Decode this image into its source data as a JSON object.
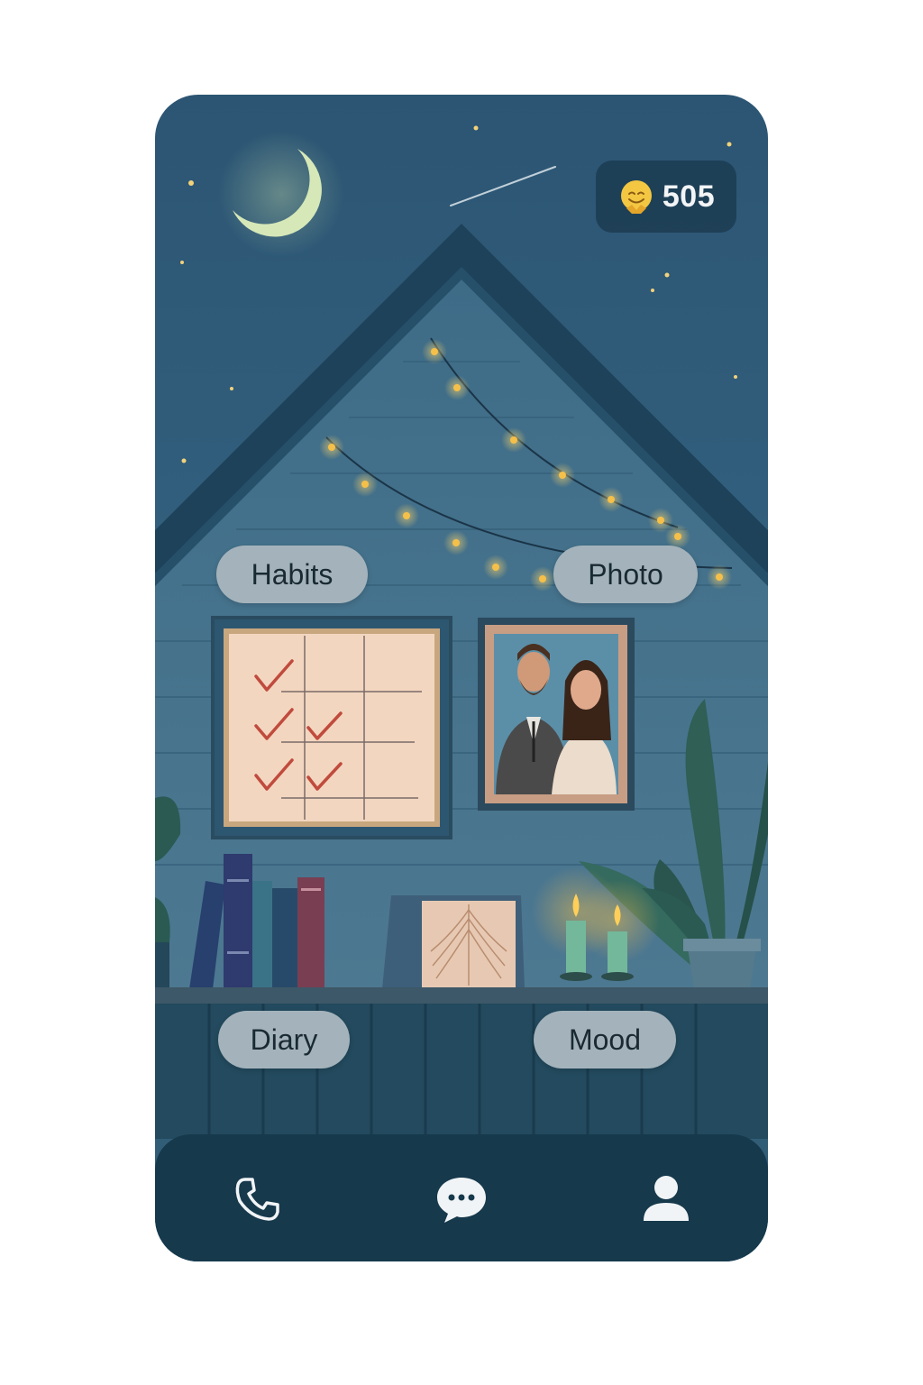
{
  "status": {
    "coins": "505",
    "coin_icon": "smiley-coin-icon"
  },
  "rooms": {
    "habits_label": "Habits",
    "photo_label": "Photo",
    "diary_label": "Diary",
    "mood_label": "Mood"
  },
  "bottom_nav": [
    {
      "icon": "phone-icon"
    },
    {
      "icon": "chat-bubble-icon"
    },
    {
      "icon": "profile-icon"
    }
  ],
  "colors": {
    "sky": "#2c5573",
    "house_wall": "#3f6d88",
    "roof": "#1f4760",
    "nav_bg": "#16394c",
    "pill_bg": "#a4b3bb",
    "string_light": "#f5c04a",
    "moon": "#d6e8b8"
  }
}
